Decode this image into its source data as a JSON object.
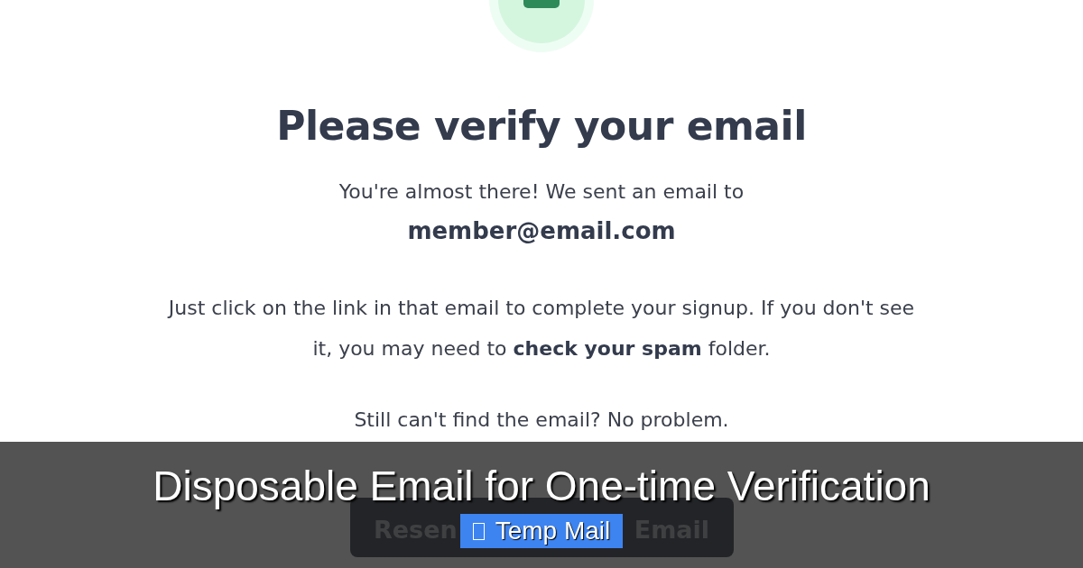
{
  "heading": "Please verify your email",
  "intro": "You're almost there! We sent an email to",
  "email": "member@email.com",
  "instructions": "Just click on the link in that email to complete your signup. If you don't see it, you may need to **check your spam** folder.",
  "fallback": "Still can't find the email? No problem.",
  "resend_button": {
    "label_parts": [
      "Resen",
      "Email"
    ]
  },
  "banner": {
    "title": "Disposable Email for One-time Verification",
    "badge": "Temp Mail"
  }
}
